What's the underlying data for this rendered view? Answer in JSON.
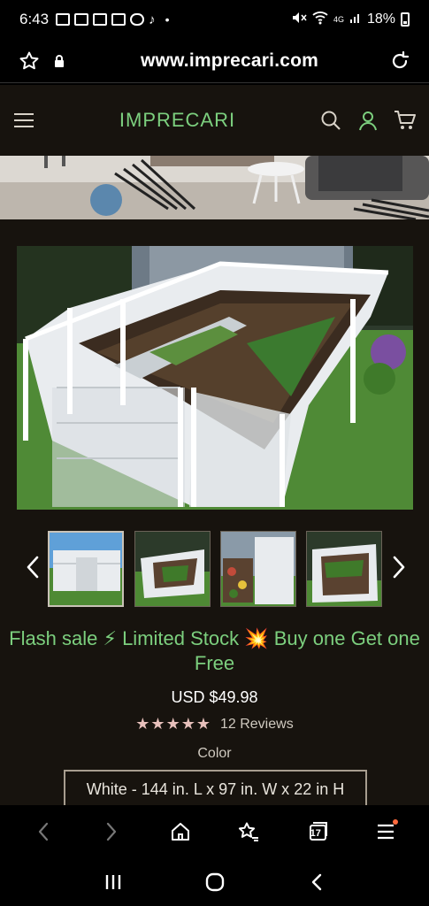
{
  "status_bar": {
    "time": "6:43",
    "network": "4G",
    "battery": "18%"
  },
  "browser": {
    "url": "www.imprecari.com"
  },
  "site": {
    "brand": "IMPRECARI"
  },
  "product": {
    "promo": "Flash sale ⚡ Limited Stock 💥 Buy one Get one Free",
    "price": "USD $49.98",
    "rating_stars": "★★★★★",
    "rating_value": 5,
    "reviews": "12 Reviews",
    "color_label": "Color",
    "selected_variant": "White - 144 in. L x 97 in. W x 22 in H"
  },
  "toolbar": {
    "tab_count": "17"
  },
  "colors": {
    "brand_green": "#7ccf7e",
    "page_bg": "#17130e",
    "star": "#e7c0bb"
  },
  "icons": [
    "star-outline-icon",
    "lock-icon",
    "reload-icon",
    "menu-icon",
    "search-icon",
    "account-icon",
    "cart-icon",
    "chevron-left-icon",
    "chevron-right-icon",
    "back-icon",
    "forward-icon",
    "home-icon",
    "bookmarks-icon",
    "tabs-icon",
    "more-menu-icon",
    "recent-apps-icon",
    "home-circle-icon",
    "system-back-icon"
  ]
}
